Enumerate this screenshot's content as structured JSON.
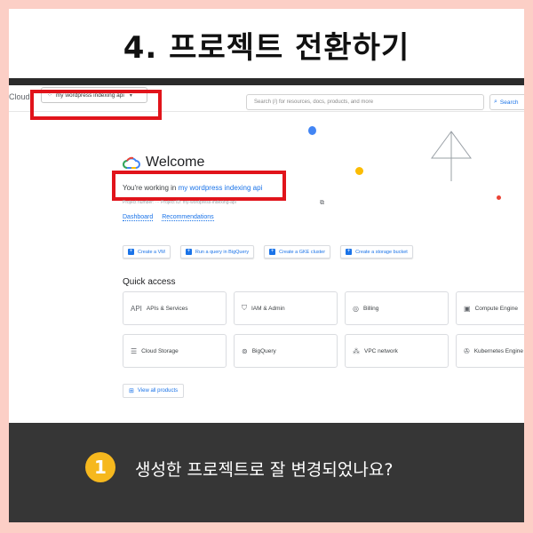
{
  "heading": "4. 프로젝트 전환하기",
  "colors": {
    "background": "#fccfc6",
    "highlight_box": "#e1141b",
    "footer": "#363636",
    "badge": "#f6b81e",
    "link": "#1a73e8"
  },
  "console": {
    "brand_label": "Cloud",
    "project_selector": {
      "icon": "project-dots-icon",
      "value": "my wordpress indexing api",
      "caret": "▾"
    },
    "search": {
      "placeholder": "Search (/) for resources, docs, products, and more",
      "button_label": "Search",
      "button_icon": "search-icon"
    },
    "welcome": {
      "title": "Welcome",
      "logo": "google-cloud-logo-icon"
    },
    "working_in": {
      "prefix": "You're working in",
      "project_name": "my wordpress indexing api"
    },
    "project_info": "Project number: ··· Project ID: my-wordpress-indexing-api",
    "links": [
      "Dashboard",
      "Recommendations"
    ],
    "actions": [
      {
        "label": "Create a VM",
        "icon": "plus-icon"
      },
      {
        "label": "Run a query in BigQuery",
        "icon": "plus-icon"
      },
      {
        "label": "Create a GKE cluster",
        "icon": "plus-icon"
      },
      {
        "label": "Create a storage bucket",
        "icon": "plus-icon"
      }
    ],
    "quick_access": {
      "title": "Quick access",
      "tiles": [
        {
          "label": "APIs & Services",
          "icon": "api-icon"
        },
        {
          "label": "IAM & Admin",
          "icon": "shield-icon"
        },
        {
          "label": "Billing",
          "icon": "billing-icon"
        },
        {
          "label": "Compute Engine",
          "icon": "compute-engine-icon"
        },
        {
          "label": "Cloud Storage",
          "icon": "storage-icon"
        },
        {
          "label": "BigQuery",
          "icon": "bigquery-icon"
        },
        {
          "label": "VPC network",
          "icon": "vpc-network-icon"
        },
        {
          "label": "Kubernetes Engine",
          "icon": "kubernetes-icon"
        }
      ]
    },
    "view_all": "View all products"
  },
  "footer": {
    "step_number": "1",
    "question": "생성한 프로젝트로 잘 변경되었나요?"
  }
}
